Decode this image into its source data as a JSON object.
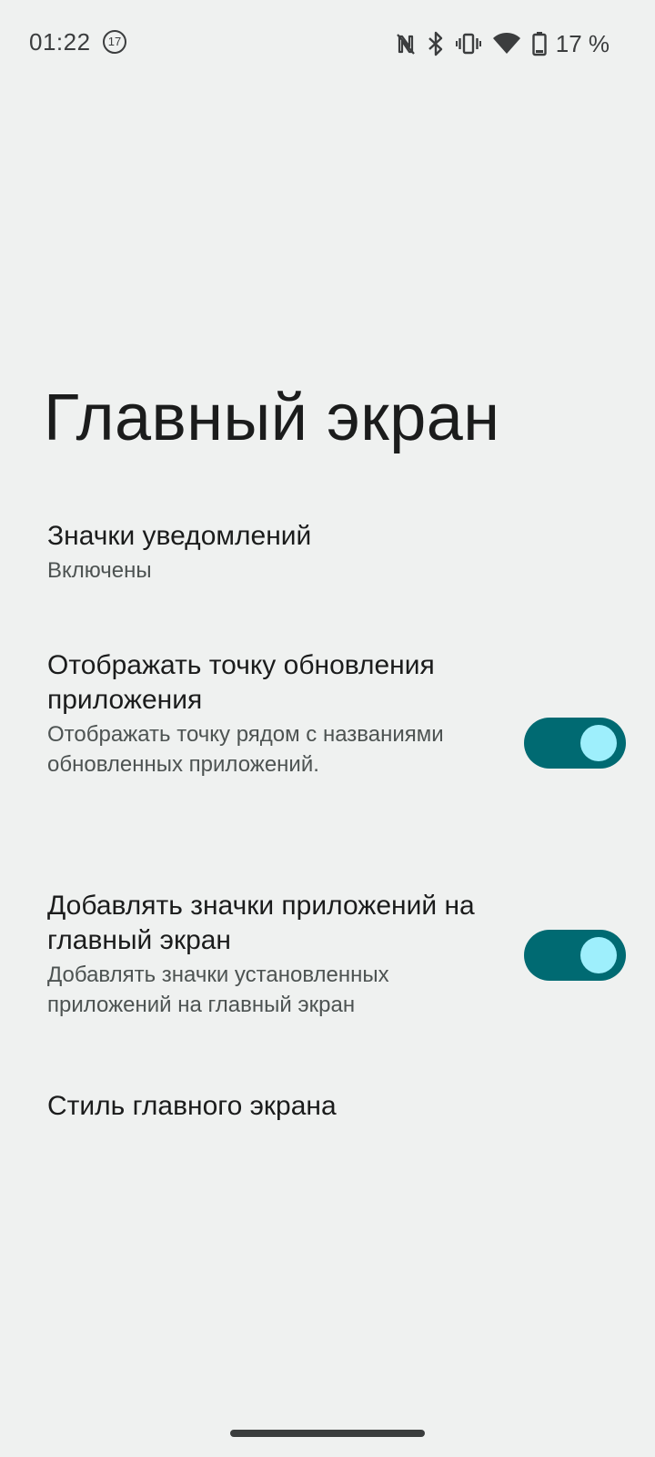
{
  "status_bar": {
    "time": "01:22",
    "notification_count": "17",
    "battery": "17 %",
    "icons": [
      "nfc-off-icon",
      "bluetooth-icon",
      "vibrate-icon",
      "wifi-icon",
      "battery-icon"
    ]
  },
  "page": {
    "title": "Главный экран"
  },
  "settings": [
    {
      "title": "Значки уведомлений",
      "subtitle": "Включены"
    },
    {
      "title": "Отображать точку обновления приложения",
      "subtitle": "Отображать точку рядом с названиями обновленных приложений.",
      "toggle": "on"
    },
    {
      "title": "Добавлять значки приложений на главный экран",
      "subtitle": "Добавлять значки установленных приложений на главный экран",
      "toggle": "on"
    },
    {
      "title": "Стиль главного экрана"
    }
  ],
  "colors": {
    "background": "#eff1f0",
    "toggle_track_on": "#006a72",
    "toggle_knob_on": "#9eeffc"
  }
}
